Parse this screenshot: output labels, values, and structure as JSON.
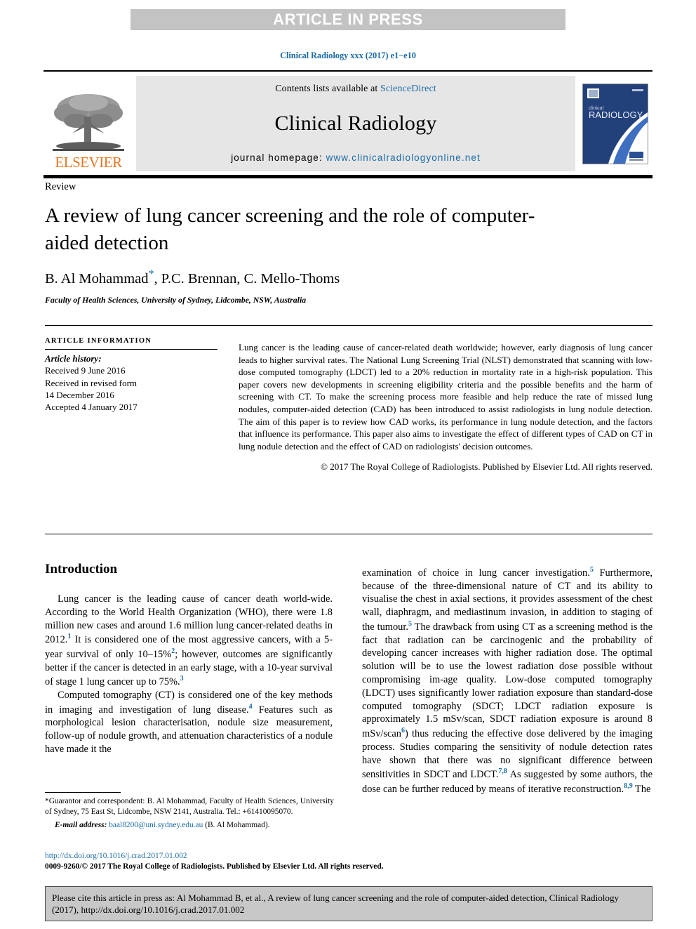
{
  "banner": {
    "text": "ARTICLE IN PRESS"
  },
  "running_head": {
    "text": "Clinical Radiology xxx (2017) e1−e10"
  },
  "masthead": {
    "publisher": "ELSEVIER",
    "contents_prefix": "Contents lists available at ",
    "contents_link": "ScienceDirect",
    "journal_name": "Clinical Radiology",
    "homepage_prefix": "journal homepage: ",
    "homepage_url": "www.clinicalradiologyonline.net",
    "cover_title_small": "clinical",
    "cover_title_large": "RADIOLOGY"
  },
  "article": {
    "section_label": "Review",
    "title": "A review of lung cancer screening and the role of computer-aided detection",
    "authors_before_star": "B. Al Mohammad",
    "author_star": "*",
    "authors_after_star": ", P.C. Brennan, C. Mello-Thoms",
    "affiliation": "Faculty of Health Sciences, University of Sydney, Lidcombe, NSW, Australia"
  },
  "article_info": {
    "heading": "ARTICLE INFORMATION",
    "history_label": "Article history:",
    "lines": [
      "Received 9 June 2016",
      "Received in revised form",
      "14 December 2016",
      "Accepted 4 January 2017"
    ]
  },
  "abstract": {
    "text": "Lung cancer is the leading cause of cancer-related death worldwide; however, early diagnosis of lung cancer leads to higher survival rates. The National Lung Screening Trial (NLST) demonstrated that scanning with low-dose computed tomography (LDCT) led to a 20% reduction in mortality rate in a high-risk population. This paper covers new developments in screening eligibility criteria and the possible benefits and the harm of screening with CT. To make the screening process more feasible and help reduce the rate of missed lung nodules, computer-aided detection (CAD) has been introduced to assist radiologists in lung nodule detection. The aim of this paper is to review how CAD works, its performance in lung nodule detection, and the factors that influence its performance. This paper also aims to investigate the effect of different types of CAD on CT in lung nodule detection and the effect of CAD on radiologists' decision outcomes.",
    "copyright": "© 2017 The Royal College of Radiologists. Published by Elsevier Ltd. All rights reserved."
  },
  "body": {
    "heading": "Introduction",
    "left_par1_a": "Lung cancer is the leading cause of cancer death world-wide. According to the World Health Organization (WHO), there were 1.8 million new cases and around 1.6 million lung cancer-related deaths in 2012.",
    "left_par1_ref1": "1",
    "left_par1_b": " It is considered one of the most aggressive cancers, with a 5-year survival of only 10–15%",
    "left_par1_ref2": "2",
    "left_par1_c": "; however, outcomes are significantly better if the cancer is detected in an early stage, with a 10-year survival of stage 1 lung cancer up to 75%.",
    "left_par1_ref3": "3",
    "left_par2_a": "Computed tomography (CT) is considered one of the key methods in imaging and investigation of lung disease.",
    "left_par2_ref4": "4",
    "left_par2_b": " Features such as morphological lesion characterisation, nodule size measurement, follow-up of nodule growth, and attenuation characteristics of a nodule have made it the",
    "right_par_a": "examination of choice in lung cancer investigation.",
    "right_ref5a": "5",
    "right_par_b": " Furthermore, because of the three-dimensional nature of CT and its ability to visualise the chest in axial sections, it provides assessment of the chest wall, diaphragm, and mediastinum invasion, in addition to staging of the tumour.",
    "right_ref5b": "5",
    "right_par_c": " The drawback from using CT as a screening method is the fact that radiation can be carcinogenic and the probability of developing cancer increases with higher radiation dose. The optimal solution will be to use the lowest radiation dose possible without compromising im-age quality. Low-dose computed tomography (LDCT) uses significantly lower radiation exposure than standard-dose computed tomography (SDCT; LDCT radiation exposure is approximately 1.5 mSv/scan, SDCT radiation exposure is around 8 mSv/scan",
    "right_ref6": "6",
    "right_par_d": ") thus reducing the effective dose delivered by the imaging process. Studies comparing the sensitivity of nodule detection rates have shown that there was no significant difference between sensitivities in SDCT and LDCT.",
    "right_ref78": "7,8",
    "right_par_e": " As suggested by some authors, the dose can be further reduced by means of iterative reconstruction.",
    "right_ref89": "8,9",
    "right_par_f": " The"
  },
  "footnotes": {
    "corresponding": "*Guarantor and correspondent: B. Al Mohammad, Faculty of Health Sciences, University of Sydney, 75 East St, Lidcombe, NSW 2141, Australia. Tel.: +61410095070.",
    "email_label": "E-mail address:",
    "email": "baal8200@uni.sydney.edu.au",
    "email_suffix": " (B. Al Mohammad)."
  },
  "doi_footer": {
    "doi_url": "http://dx.doi.org/10.1016/j.crad.2017.01.002",
    "issn_line": "0009-9260/© 2017 The Royal College of Radiologists. Published by Elsevier Ltd. All rights reserved."
  },
  "citation_box": {
    "text": "Please cite this article in press as: Al Mohammad B, et al., A review of lung cancer screening and the role of computer-aided detection, Clinical Radiology (2017), http://dx.doi.org/10.1016/j.crad.2017.01.002"
  },
  "colors": {
    "link_blue": "#1b6ca8",
    "elsevier_orange": "#e87722",
    "banner_gray": "#c3c3c3",
    "band_gray": "#e6e6e6",
    "cite_gray": "#c8c8c8",
    "cover_navy": "#1f3f77"
  }
}
